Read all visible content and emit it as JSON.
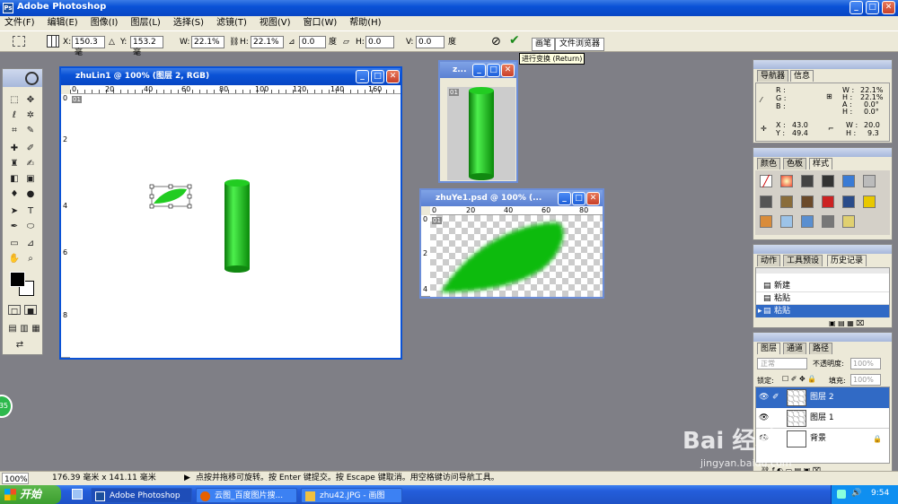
{
  "app": {
    "title": "Adobe Photoshop"
  },
  "menu": [
    "文件(F)",
    "编辑(E)",
    "图像(I)",
    "图层(L)",
    "选择(S)",
    "滤镜(T)",
    "视图(V)",
    "窗口(W)",
    "帮助(H)"
  ],
  "options": {
    "x_label": "X:",
    "x": "150.3 毫",
    "y_label": "Y:",
    "y": "153.2 毫",
    "w_label": "W:",
    "w": "22.1%",
    "h_label": "H:",
    "h": "22.1%",
    "angle": "0.0",
    "angle_unit": "度",
    "hskew_label": "H:",
    "hskew": "0.0",
    "vskew_label": "V:",
    "vskew": "0.0",
    "skew_unit": "度",
    "tab_brush": "画笔",
    "tab_browser": "文件浏览器",
    "tooltip": "进行变换 (Return)"
  },
  "doc1": {
    "title": "zhuLin1 @ 100% (图层 2, RGB)",
    "ruler": [
      "0",
      "20",
      "40",
      "60",
      "80",
      "100",
      "120",
      "140",
      "160"
    ],
    "vruler": [
      "0",
      "2",
      "4",
      "6",
      "8"
    ],
    "badge": "01"
  },
  "doc2": {
    "title": "z...",
    "badge": "01"
  },
  "doc3": {
    "title": "zhuYe1.psd @ 100% (...",
    "ruler": [
      "0",
      "20",
      "40",
      "60",
      "80"
    ],
    "vruler": [
      "0",
      "2",
      "4"
    ],
    "badge": "01"
  },
  "nav": {
    "tab1": "导航器",
    "tab2": "信息",
    "r": "R :",
    "g": "G :",
    "b": "B :",
    "w1": "W :",
    "w1v": "22.1%",
    "h1": "H :",
    "h1v": "22.1%",
    "a": "A :",
    "av": "0.0°",
    "h2": "H :",
    "h2v": "0.0°",
    "x": "X :",
    "xv": "43.0",
    "y": "Y :",
    "yv": "49.4",
    "w2": "W :",
    "w2v": "20.0",
    "h3": "H :",
    "h3v": "9.3"
  },
  "swatches": {
    "tab1": "颜色",
    "tab2": "色板",
    "tab3": "样式"
  },
  "history": {
    "tab1": "动作",
    "tab2": "工具预设",
    "tab3": "历史记录",
    "items": [
      "新建",
      "粘贴",
      "粘贴"
    ]
  },
  "layers": {
    "tab1": "图层",
    "tab2": "通道",
    "tab3": "路径",
    "mode": "正常",
    "opacity_label": "不透明度:",
    "opacity": "100%",
    "lock_label": "锁定:",
    "fill_label": "填充:",
    "fill": "100%",
    "items": [
      "图层 2",
      "图层 1",
      "背景"
    ]
  },
  "status": {
    "zoom": "100%",
    "size": "176.39 毫米 x 141.11 毫米",
    "hint": "点按并拖移可旋转。按 Enter 键提交。按 Escape 键取消。用空格键访问导航工具。"
  },
  "taskbar": {
    "start": "开始",
    "items": [
      "Adobe Photoshop",
      "云图_百度图片搜...",
      "zhu42.JPG - 画图"
    ],
    "time": "9:54"
  },
  "badge35": "35",
  "watermark": {
    "logo": "Bai 经验",
    "url": "jingyan.baidu.com"
  },
  "colors": {
    "titlebar": "#0a52d6",
    "leaf": "#22cc22",
    "taskbar": "#245edb",
    "start": "#3c9e2f"
  }
}
